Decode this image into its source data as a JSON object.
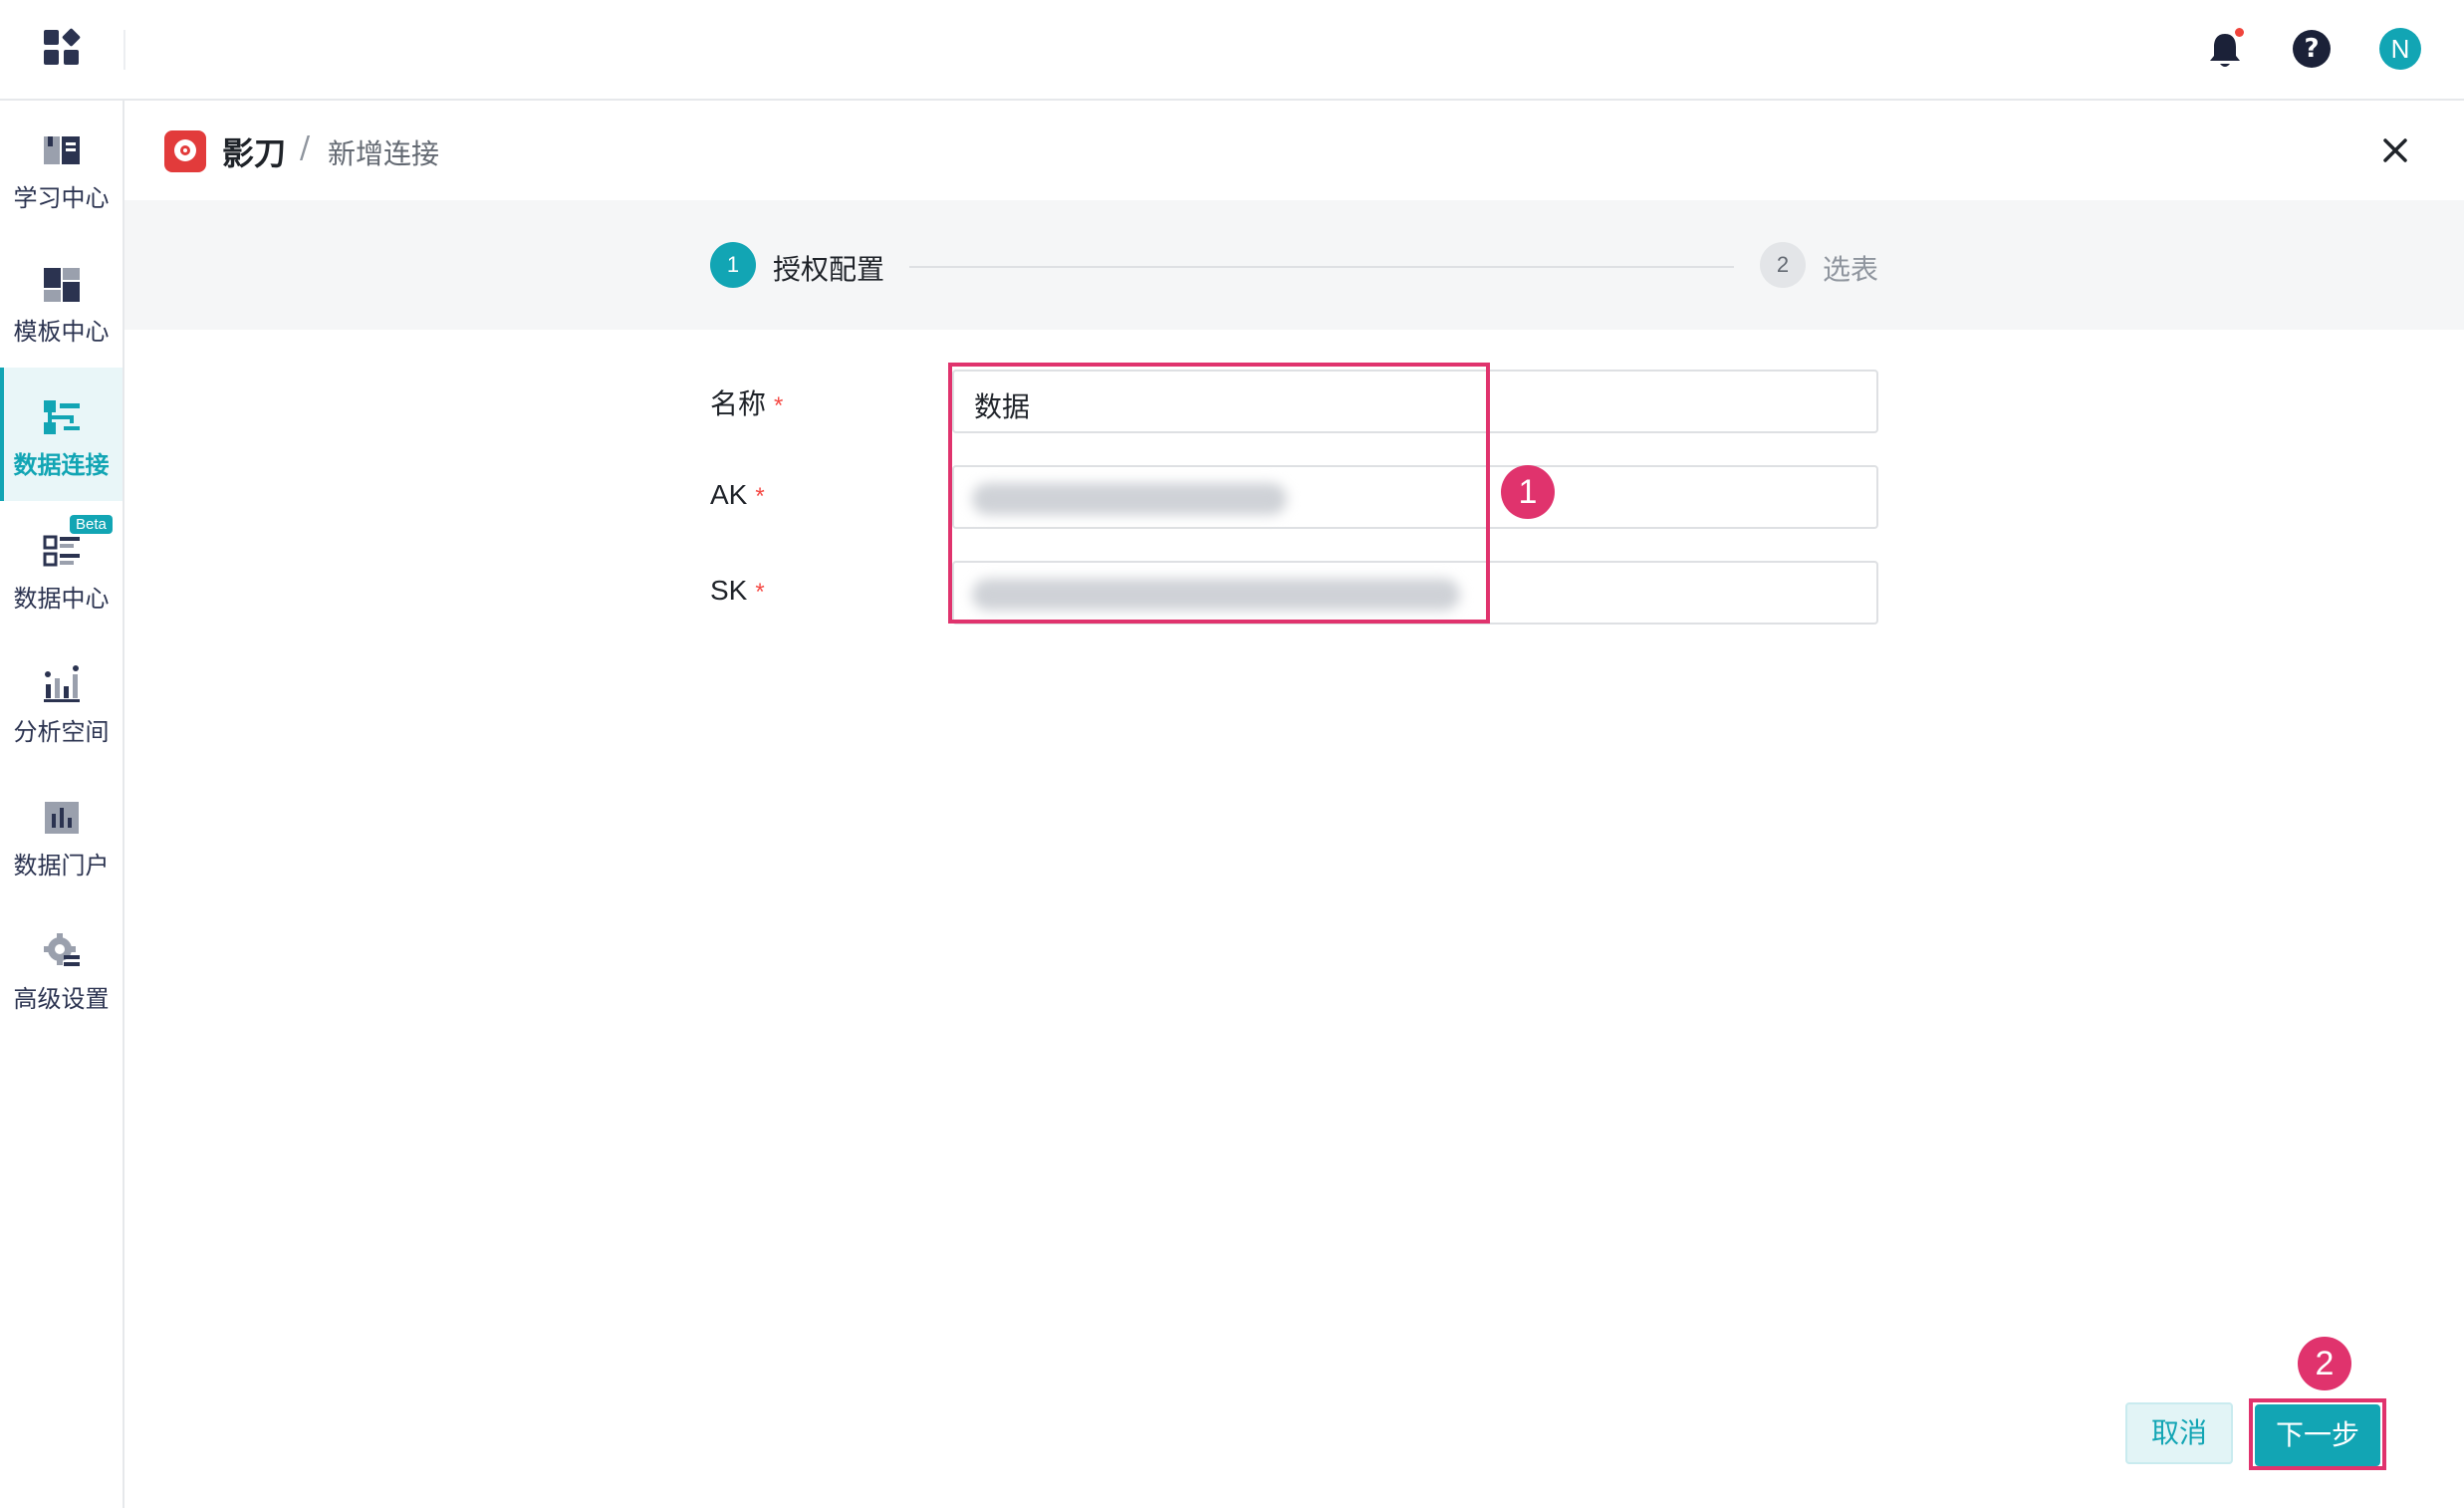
{
  "header": {
    "app_avatar_initial": "N",
    "icons": [
      "apps-grid-icon",
      "bell-icon",
      "help-icon",
      "avatar"
    ]
  },
  "sidebar": {
    "items": [
      {
        "label": "学习中心",
        "icon": "book-icon"
      },
      {
        "label": "模板中心",
        "icon": "template-icon"
      },
      {
        "label": "数据连接",
        "icon": "data-connection-icon",
        "active": true
      },
      {
        "label": "数据中心",
        "icon": "data-center-icon",
        "badge": "Beta"
      },
      {
        "label": "分析空间",
        "icon": "analysis-icon"
      },
      {
        "label": "数据门户",
        "icon": "portal-icon"
      },
      {
        "label": "高级设置",
        "icon": "settings-icon"
      }
    ]
  },
  "page": {
    "brand": "影刀",
    "breadcrumb_sep": "/",
    "breadcrumb_current": "新增连接"
  },
  "steps": [
    {
      "number": "1",
      "label": "授权配置",
      "active": true
    },
    {
      "number": "2",
      "label": "选表",
      "active": false
    }
  ],
  "form": {
    "required_mark": "*",
    "fields": [
      {
        "label": "名称",
        "value": "数据"
      },
      {
        "label": "AK",
        "value": ""
      },
      {
        "label": "SK",
        "value": ""
      }
    ]
  },
  "annotations": {
    "badge1": "1",
    "badge2": "2"
  },
  "footer": {
    "cancel_label": "取消",
    "next_label": "下一步"
  },
  "colors": {
    "accent": "#12a5b4",
    "highlight": "#e0336d",
    "required": "#f54a45"
  }
}
